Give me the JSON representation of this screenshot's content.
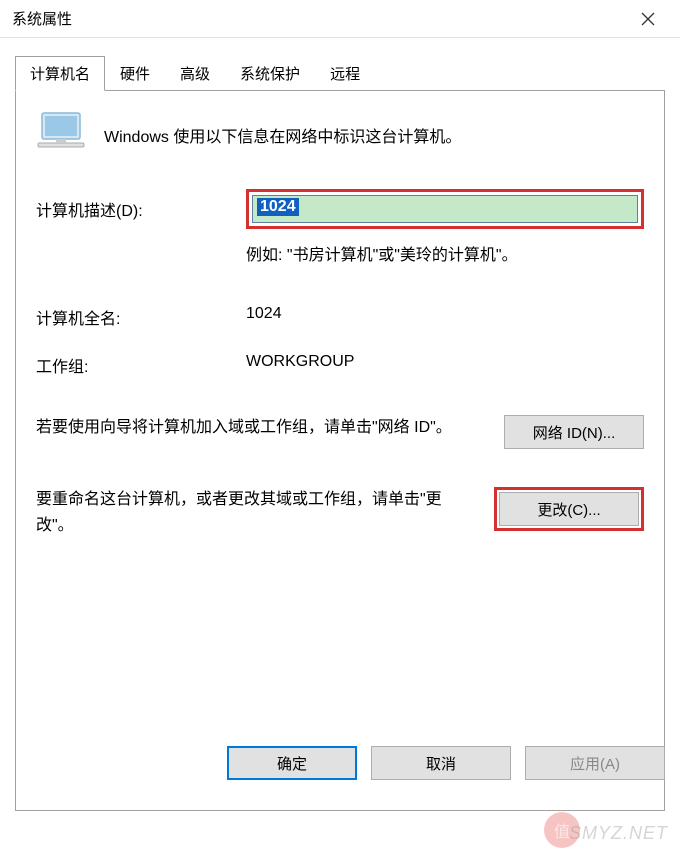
{
  "titlebar": {
    "title": "系统属性"
  },
  "tabs": [
    {
      "label": "计算机名",
      "active": true
    },
    {
      "label": "硬件",
      "active": false
    },
    {
      "label": "高级",
      "active": false
    },
    {
      "label": "系统保护",
      "active": false
    },
    {
      "label": "远程",
      "active": false
    }
  ],
  "content": {
    "intro": "Windows 使用以下信息在网络中标识这台计算机。",
    "desc_label": "计算机描述(D):",
    "desc_value": "1024",
    "desc_example": "例如: \"书房计算机\"或\"美玲的计算机\"。",
    "fullname_label": "计算机全名:",
    "fullname_value": "1024",
    "workgroup_label": "工作组:",
    "workgroup_value": "WORKGROUP",
    "network_text": "若要使用向导将计算机加入域或工作组，请单击\"网络 ID\"。",
    "network_button": "网络 ID(N)...",
    "change_text": "要重命名这台计算机，或者更改其域或工作组，请单击\"更改\"。",
    "change_button": "更改(C)..."
  },
  "buttons": {
    "ok": "确定",
    "cancel": "取消",
    "apply": "应用(A)"
  },
  "watermark": "SMYZ.NET",
  "watermark_badge": "值"
}
